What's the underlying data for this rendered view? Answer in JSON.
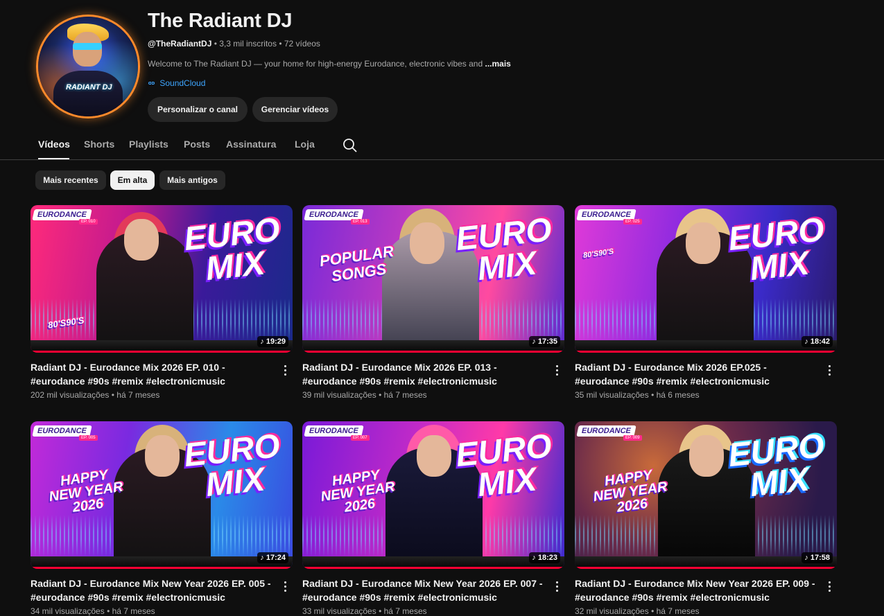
{
  "channel": {
    "name": "The Radiant DJ",
    "handle": "@TheRadiantDJ",
    "subscribers": "3,3 mil inscritos",
    "videos_count": "72 vídeos",
    "separator": "•",
    "description": "Welcome to The Radiant DJ — your home for high-energy Eurodance, electronic vibes and",
    "more_label": "...mais",
    "link_label": "SoundCloud",
    "avatar_logo": "RADIANT DJ",
    "buttons": {
      "customize": "Personalizar o canal",
      "manage": "Gerenciar vídeos"
    }
  },
  "tabs": [
    "Vídeos",
    "Shorts",
    "Playlists",
    "Posts",
    "Assinatura",
    "Loja"
  ],
  "chips": [
    "Mais recentes",
    "Em alta",
    "Mais antigos"
  ],
  "videos": [
    {
      "title": "Radiant DJ - Eurodance Mix 2026 EP. 010 - #eurodance #90s #remix #electronicmusic",
      "views": "202 mil visualizações",
      "age": "há 7 meses",
      "duration": "19:29",
      "thumb_tag": "EURODANCE",
      "thumb_ep": "EP. 010",
      "thumb_main": "EURO MIX",
      "thumb_sub": "80'S90'S"
    },
    {
      "title": "Radiant DJ - Eurodance Mix 2026 EP. 013 - #eurodance #90s #remix #electronicmusic",
      "views": "39 mil visualizações",
      "age": "há 7 meses",
      "duration": "17:35",
      "thumb_tag": "EURODANCE",
      "thumb_ep": "EP. 013",
      "thumb_main": "EURO MIX",
      "thumb_sub": "POPULAR SONGS"
    },
    {
      "title": "Radiant DJ - Eurodance Mix 2026 EP.025 - #eurodance #90s #remix #electronicmusic",
      "views": "35 mil visualizações",
      "age": "há 6 meses",
      "duration": "18:42",
      "thumb_tag": "EURODANCE",
      "thumb_ep": "EP. 025",
      "thumb_main": "EURO MIX",
      "thumb_sub": "80'S90'S"
    },
    {
      "title": "Radiant DJ - Eurodance Mix New Year 2026 EP. 005 - #eurodance  #90s #remix #electronicmusic",
      "views": "34 mil visualizações",
      "age": "há 7 meses",
      "duration": "17:24",
      "thumb_tag": "EURODANCE",
      "thumb_ep": "EP. 005",
      "thumb_main": "EURO MIX",
      "thumb_sub": "HAPPY NEW YEAR 2026"
    },
    {
      "title": "Radiant DJ - Eurodance Mix New Year 2026 EP. 007 - #eurodance  #90s #remix #electronicmusic",
      "views": "33 mil visualizações",
      "age": "há 7 meses",
      "duration": "18:23",
      "thumb_tag": "EURODANCE",
      "thumb_ep": "EP. 007",
      "thumb_main": "EURO MIX",
      "thumb_sub": "HAPPY NEW YEAR 2026"
    },
    {
      "title": "Radiant DJ - Eurodance Mix New Year 2026 EP. 009 - #eurodance  #90s #remix #electronicmusic",
      "views": "32 mil visualizações",
      "age": "há 7 meses",
      "duration": "17:58",
      "thumb_tag": "EURODANCE",
      "thumb_ep": "EP. 009",
      "thumb_main": "EURO MIX",
      "thumb_sub": "HAPPY NEW YEAR 2026"
    }
  ],
  "colors": {
    "background": "#0f0f0f",
    "chip": "#272727",
    "link": "#3ea6ff",
    "progress": "#ff0033"
  },
  "icons": [
    "search-icon",
    "link-icon",
    "more-vert-icon",
    "music-note-icon"
  ]
}
